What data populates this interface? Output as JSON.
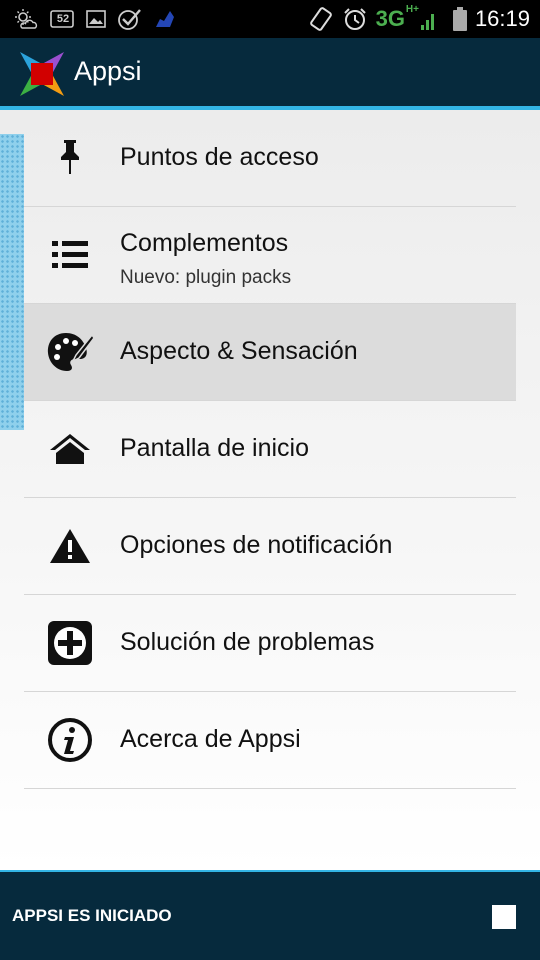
{
  "status_bar": {
    "icons_left": [
      "weather-icon",
      "notification-52-icon",
      "image-icon",
      "check-icon",
      "app-icon"
    ],
    "badge_number": "52",
    "network": "3G",
    "network_sup": "H+",
    "time": "16:19"
  },
  "app": {
    "title": "Appsi"
  },
  "menu": {
    "items": [
      {
        "label": "Puntos de acceso",
        "icon": "pin-icon"
      },
      {
        "label": "Complementos",
        "sub": "Nuevo: plugin packs",
        "icon": "list-icon"
      },
      {
        "label": "Aspecto & Sensación",
        "icon": "palette-icon"
      },
      {
        "label": "Pantalla de inicio",
        "icon": "home-icon"
      },
      {
        "label": "Opciones de notificación",
        "icon": "warning-icon"
      },
      {
        "label": "Solución de problemas",
        "icon": "plus-box-icon"
      },
      {
        "label": "Acerca de Appsi",
        "icon": "info-icon"
      }
    ]
  },
  "footer": {
    "text": "APPSI ES INICIADO",
    "checkbox_checked": false
  },
  "colors": {
    "actionbar": "#062a3d",
    "accent": "#33b5e5",
    "selected_row": "#dcdcdc"
  }
}
